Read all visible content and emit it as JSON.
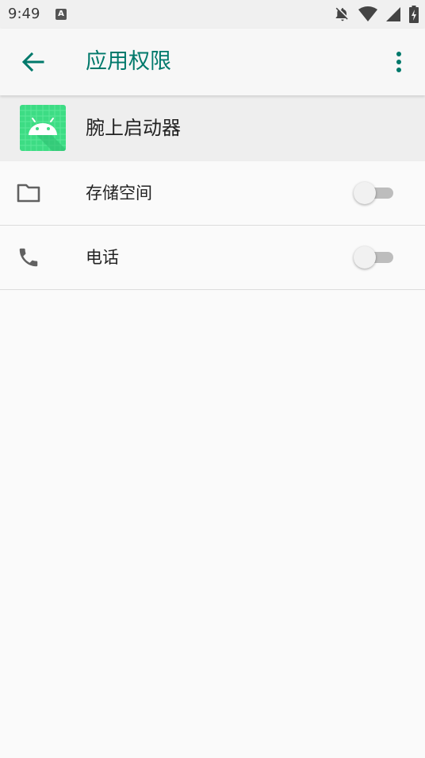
{
  "status_bar": {
    "time": "9:49",
    "notification_icon": "a-letter-icon",
    "notification_letter": "A",
    "icons": [
      "notifications-off-icon",
      "wifi-icon",
      "cell-signal-icon",
      "battery-charging-icon"
    ]
  },
  "app_bar": {
    "title": "应用权限",
    "back_icon": "arrow-back-icon",
    "menu_icon": "more-vert-icon"
  },
  "app": {
    "name": "腕上启动器",
    "icon": "android-app-icon"
  },
  "permissions": [
    {
      "label": "存储空间",
      "icon": "folder-icon",
      "enabled": false
    },
    {
      "label": "电话",
      "icon": "phone-icon",
      "enabled": false
    }
  ],
  "colors": {
    "accent": "#00796b",
    "app_icon_bg": "#3ddc84",
    "switch_track_off": "#bdbdbd",
    "switch_thumb_off": "#f1f1f1"
  }
}
